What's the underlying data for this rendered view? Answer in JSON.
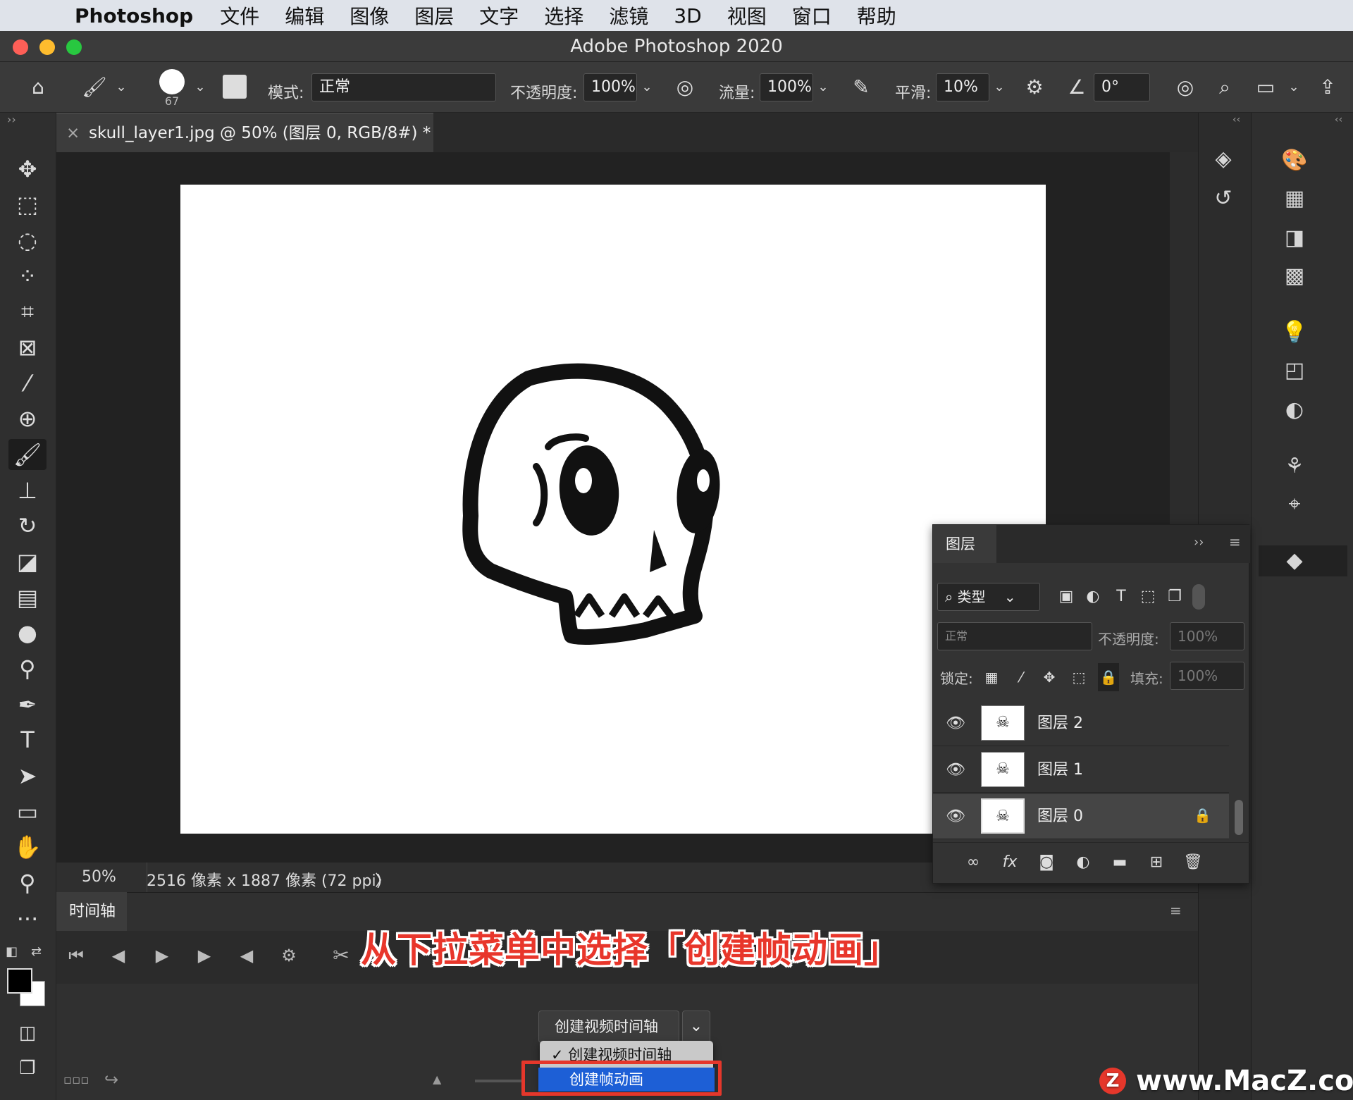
{
  "menubar": {
    "app": "Photoshop",
    "items": [
      "文件",
      "编辑",
      "图像",
      "图层",
      "文字",
      "选择",
      "滤镜",
      "3D",
      "视图",
      "窗口",
      "帮助"
    ]
  },
  "window": {
    "title": "Adobe Photoshop 2020"
  },
  "options": {
    "brush_size": "67",
    "mode_label": "模式:",
    "mode_value": "正常",
    "opacity_label": "不透明度:",
    "opacity_value": "100%",
    "flow_label": "流量:",
    "flow_value": "100%",
    "smooth_label": "平滑:",
    "smooth_value": "10%",
    "angle_value": "0°"
  },
  "document": {
    "tab_title": "skull_layer1.jpg @ 50% (图层 0, RGB/8#) *",
    "close": "×"
  },
  "status": {
    "zoom": "50%",
    "info": "2516 像素 x 1887 像素 (72 ppi)",
    "arrow": "〉"
  },
  "timeline": {
    "tab": "时间轴",
    "dropdown_value": "创建视频时间轴",
    "menu_items": [
      "✓ 创建视频时间轴",
      "创建帧动画"
    ]
  },
  "layers_panel": {
    "title": "图层",
    "filter_label": "类型",
    "blend_mode": "正常",
    "opacity_label": "不透明度:",
    "opacity_value": "100%",
    "lock_label": "锁定:",
    "fill_label": "填充:",
    "fill_value": "100%",
    "layers": [
      {
        "name": "图层 2"
      },
      {
        "name": "图层 1"
      },
      {
        "name": "图层 0"
      }
    ]
  },
  "caption": "从下拉菜单中选择「创建帧动画」",
  "watermark": {
    "logo": "Z",
    "text": "www.MacZ.com"
  },
  "colors": {
    "highlight": "#e5372b",
    "menu_select": "#1d5fd6"
  }
}
